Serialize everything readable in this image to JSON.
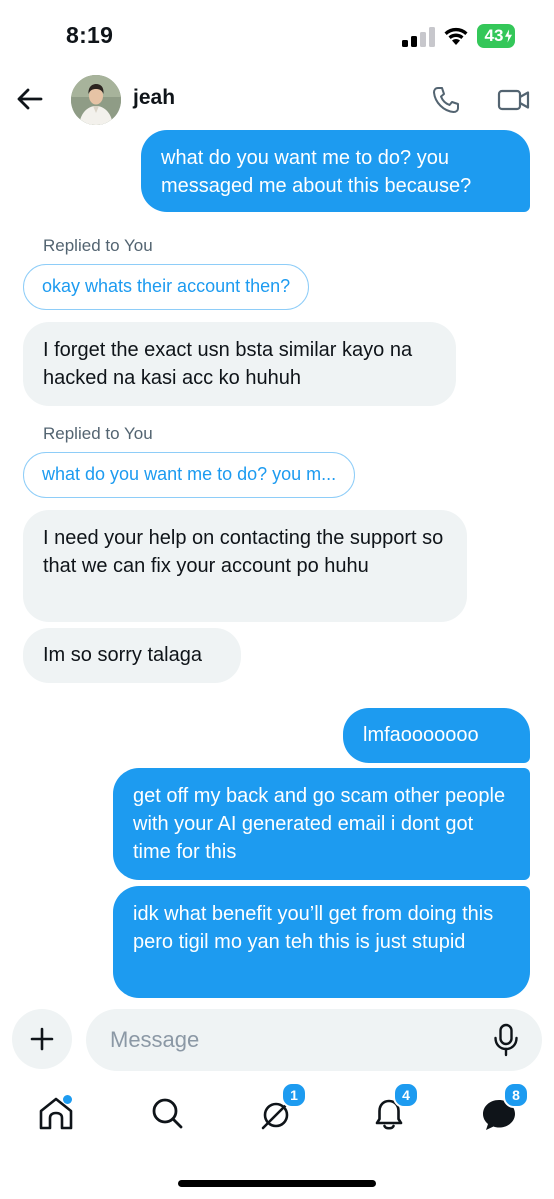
{
  "status_bar": {
    "time": "8:19",
    "battery": "43",
    "battery_color": "#34c759"
  },
  "header": {
    "back_icon": "arrow-left-icon",
    "contact_name": "jeah",
    "call_icon": "phone-icon",
    "video_icon": "video-camera-icon"
  },
  "messages": [
    {
      "direction": "outgoing",
      "text": "what do you want me to do? you messaged me about this because?"
    },
    {
      "replied_label": "Replied to You",
      "quoted": "okay whats their account then?"
    },
    {
      "direction": "incoming",
      "text": "I forget the exact usn bsta similar kayo na hacked na kasi acc ko huhuh"
    },
    {
      "replied_label": "Replied to You",
      "quoted": "what do you want me to do? you m..."
    },
    {
      "direction": "incoming",
      "text": "I need your help on contacting the support so that we can fix your account po huhu"
    },
    {
      "direction": "incoming",
      "text": "Im so sorry talaga"
    },
    {
      "direction": "outgoing",
      "text": "lmfaooooooo"
    },
    {
      "direction": "outgoing",
      "text": "get off my back and go scam other people with your AI generated email i dont got time for this"
    },
    {
      "direction": "outgoing",
      "text": "idk what benefit you’ll get from doing this pero tigil mo yan teh this is just stupid"
    }
  ],
  "composer": {
    "placeholder": "Message",
    "plus_icon": "plus-icon",
    "mic_icon": "microphone-icon"
  },
  "tabbar": {
    "home": {
      "icon": "home-icon",
      "has_dot": true
    },
    "search": {
      "icon": "search-icon"
    },
    "grok": {
      "icon": "grok-icon",
      "badge": "1"
    },
    "notifications": {
      "icon": "bell-icon",
      "badge": "4"
    },
    "messages": {
      "icon": "messages-icon",
      "badge": "8"
    }
  },
  "colors": {
    "accent": "#1d9bf0",
    "incoming_bubble": "#eff3f4",
    "muted_text": "#536471"
  }
}
